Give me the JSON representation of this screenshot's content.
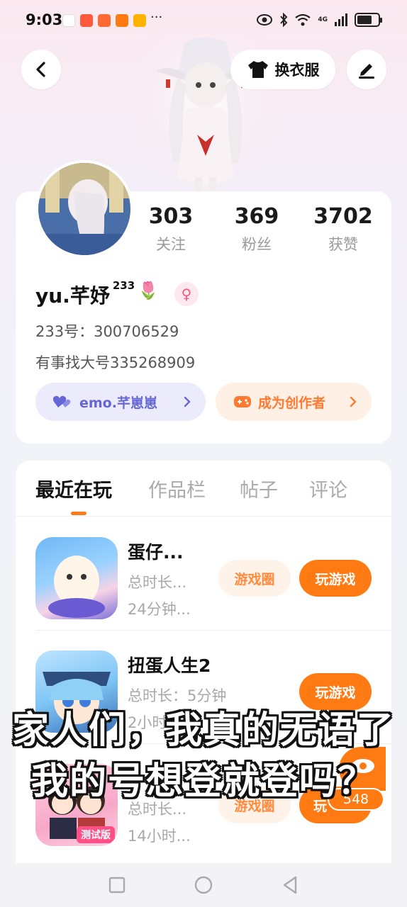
{
  "status_bar": {
    "time": "9:03",
    "more": "···",
    "network": "4G"
  },
  "header": {
    "wardrobe_label": "换衣服"
  },
  "profile": {
    "stats": [
      {
        "value": "303",
        "label": "关注"
      },
      {
        "value": "369",
        "label": "粉丝"
      },
      {
        "value": "3702",
        "label": "获赞"
      }
    ],
    "username": "yu.芊妤",
    "username_sup": "233",
    "username_emoji": "🌷",
    "gender_symbol": "♀",
    "uid": "233号：300706529",
    "bio": "有事找大号335268909",
    "chip_emo": "emo.芊崽崽",
    "chip_creator": "成为创作者"
  },
  "tabs": [
    "最近在玩",
    "作品栏",
    "帖子",
    "评论"
  ],
  "games": [
    {
      "title": "蛋仔...",
      "meta1": "总时长...",
      "meta2": "24分钟...",
      "circle_label": "游戏圈",
      "play_label": "玩游戏"
    },
    {
      "title": "扭蛋人生2",
      "meta1": "总时长：5分钟",
      "meta2": "2小时",
      "play_label": "玩游戏"
    },
    {
      "title": "",
      "meta1": "总时长...",
      "meta2": "14小时...",
      "circle_label": "游戏圈",
      "play_label": "玩",
      "icon_badge": "测试版"
    }
  ],
  "overlay": {
    "subtitle_line1": "家人们，我真的无语了",
    "subtitle_line2": "我的号想登就登吗？",
    "count": "548"
  },
  "colors": {
    "accent": "#ff7a12",
    "emo": "#6566d8",
    "gender": "#f05a84"
  }
}
